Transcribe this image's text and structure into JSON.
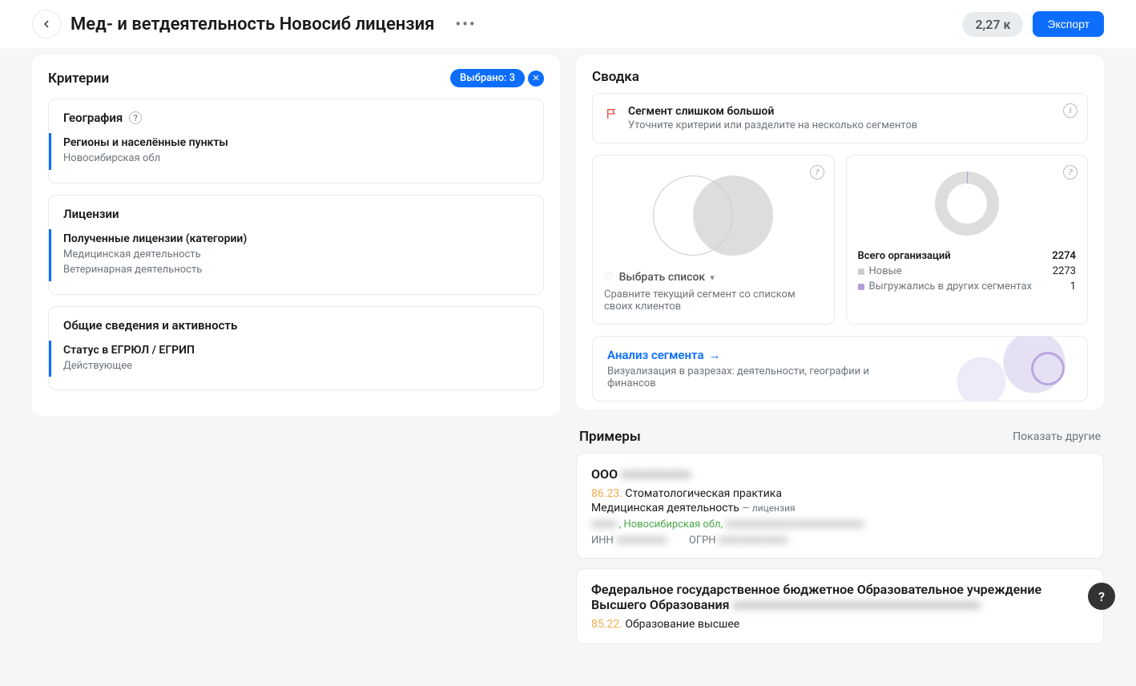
{
  "header": {
    "title": "Мед- и ветдеятельность Новосиб лицензия",
    "count": "2,27 к",
    "export_label": "Экспорт"
  },
  "criteria": {
    "panel_title": "Критерии",
    "selected_chip": "Выбрано: 3",
    "groups": [
      {
        "title": "География",
        "help": true,
        "items": [
          {
            "name": "Регионы и населённые пункты",
            "value": "Новосибирская обл"
          }
        ]
      },
      {
        "title": "Лицензии",
        "help": false,
        "items": [
          {
            "name": "Полученные лицензии (категории)",
            "value": "Медицинская деятельность\nВетеринарная деятельность"
          }
        ]
      },
      {
        "title": "Общие сведения и активность",
        "help": false,
        "items": [
          {
            "name": "Статус в ЕГРЮЛ / ЕГРИП",
            "value": "Действующее"
          }
        ]
      }
    ]
  },
  "summary": {
    "panel_title": "Сводка",
    "alert_title": "Сегмент слишком большой",
    "alert_desc": "Уточните критерии или разделите на несколько сегментов",
    "select_list_label": "Выбрать список",
    "compare_hint": "Сравните текущий сегмент со списком своих клиентов",
    "totals_label": "Всего организаций",
    "totals_value": "2274",
    "new_label": "Новые",
    "new_value": "2273",
    "exported_label": "Выгружались в других сегментах",
    "exported_value": "1",
    "analysis_link": "Анализ сегмента",
    "analysis_desc": "Визуализация в разрезах: деятельности, географии и финансов"
  },
  "examples": {
    "title": "Примеры",
    "show_other": "Показать другие",
    "items": [
      {
        "name_prefix": "ООО",
        "name_hidden": "■■■■■■■■■",
        "activity_code": "86.23.",
        "activity_name": "Стоматологическая практика",
        "license_name": "Медицинская деятельность",
        "license_suffix": "— лицензия",
        "location": ", Новосибирская обл,",
        "location_hidden_prefix": "■■■■",
        "location_hidden_suffix": "■■■■■■■■■■■■■■■■■■■■■■",
        "inn_label": "ИНН",
        "inn_hidden": "■■■■■■■■",
        "ogrn_label": "ОГРН",
        "ogrn_hidden": "■■■■■■■■■■■"
      },
      {
        "name_full": "Федеральное государственное бюджетное Образовательное учреждение Высшего Образования",
        "name_hidden_tail": "■■■■■■■■■■■■■■■■■■■■■■■■■■■■■■■■",
        "activity_code": "85.22.",
        "activity_name": "Образование высшее"
      }
    ]
  }
}
